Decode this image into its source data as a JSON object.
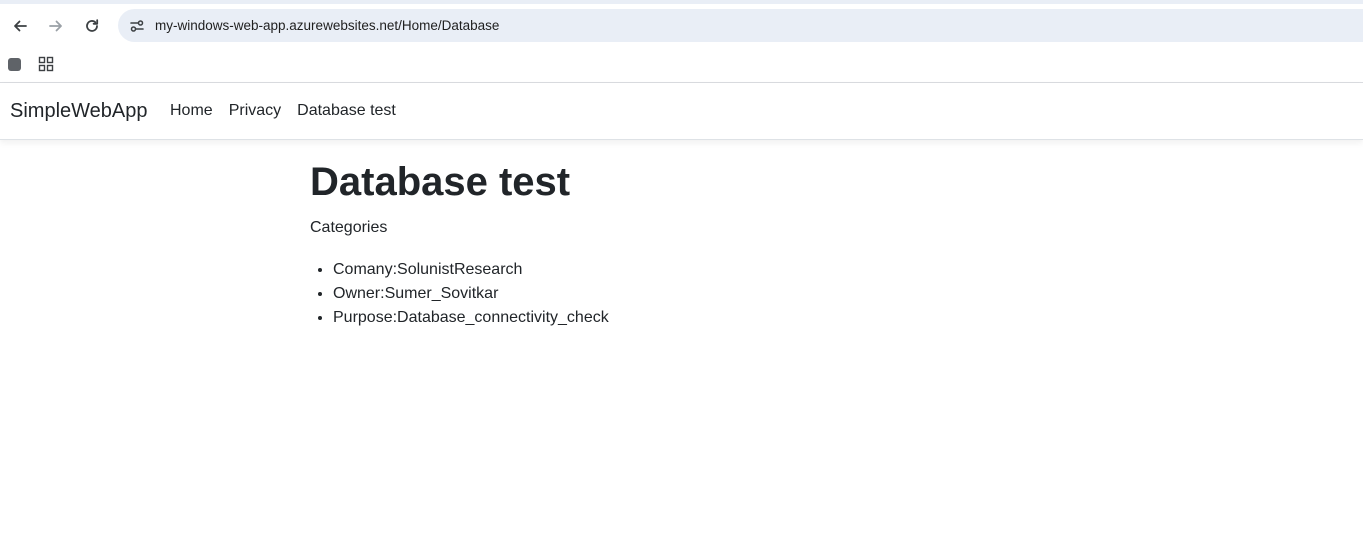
{
  "browser": {
    "url": "my-windows-web-app.azurewebsites.net/Home/Database"
  },
  "navbar": {
    "brand": "SimpleWebApp",
    "links": [
      {
        "label": "Home"
      },
      {
        "label": "Privacy"
      },
      {
        "label": "Database test"
      }
    ]
  },
  "main": {
    "title": "Database test",
    "categories_label": "Categories",
    "categories": [
      "Comany:SolunistResearch",
      "Owner:Sumer_Sovitkar",
      "Purpose:Database_connectivity_check"
    ]
  }
}
